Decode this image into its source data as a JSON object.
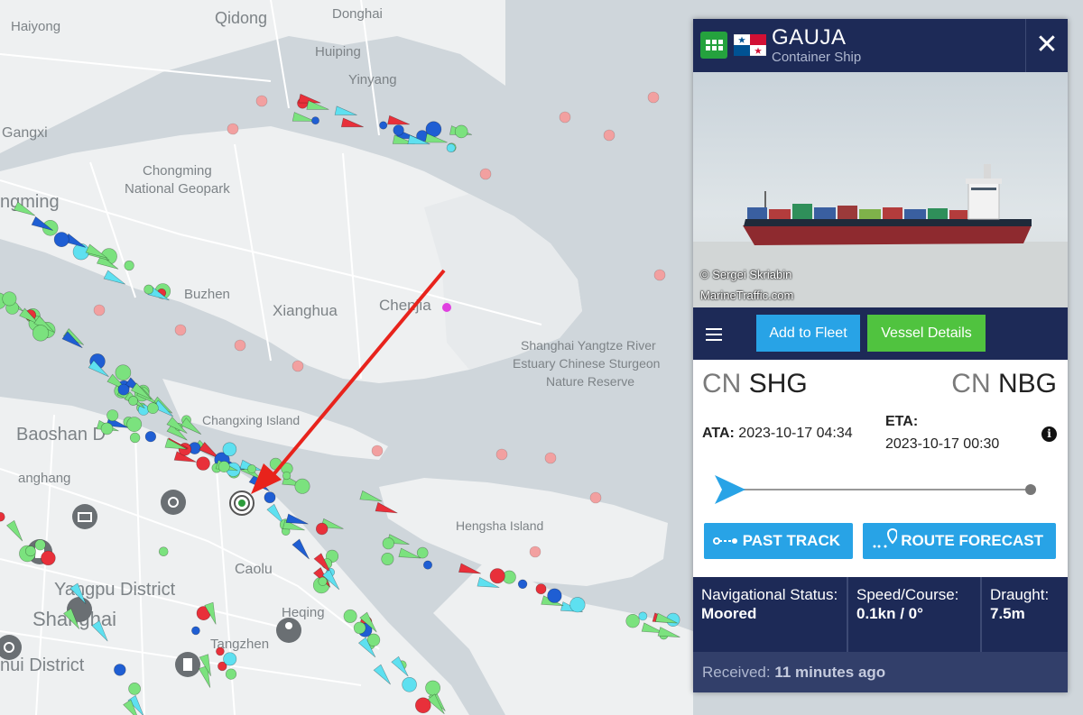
{
  "map": {
    "labels": {
      "qidong": "Qidong",
      "donghai": "Donghai",
      "haiyong": "Haiyong",
      "huiping": "Huiping",
      "yinyang": "Yinyang",
      "gangxi": "Gangxi",
      "chongming_geopark_1": "Chongming",
      "chongming_geopark_2": "National Geopark",
      "chongming": "ngming",
      "buzhen": "Buzhen",
      "xianghua": "Xianghua",
      "chenjia": "Chenjia",
      "reserve_1": "Shanghai Yangtze River",
      "reserve_2": "Estuary Chinese Sturgeon",
      "reserve_3": "Nature Reserve",
      "changxing": "Changxing Island",
      "baoshan": "Baoshan D",
      "hengsha": "Hengsha Island",
      "caolu": "Caolu",
      "yangpu": "Yangpu District",
      "shanghai": "Shanghai",
      "heqing": "Heqing",
      "tangzhen": "Tangzhen",
      "hui_district": "nui District",
      "yanghang": "anghang"
    }
  },
  "panel": {
    "vessel_name": "GAUJA",
    "vessel_type": "Container Ship",
    "flag": "Panama",
    "close_label": "✕",
    "photo_credit_1": "© Sergei Skriabin",
    "photo_credit_2": "MarineTraffic.com",
    "add_to_fleet": "Add to Fleet",
    "vessel_details": "Vessel Details",
    "from_country": "CN",
    "from_port": "SHG",
    "to_country": "CN",
    "to_port": "NBG",
    "ata_label": "ATA:",
    "ata_value": "2023-10-17 04:34",
    "eta_label": "ETA:",
    "eta_value": "2023-10-17 00:30",
    "info_icon": "i",
    "voyage_progress": 0,
    "past_track": "PAST TRACK",
    "route_forecast": "ROUTE FORECAST",
    "nav_status_label": "Navigational Status:",
    "nav_status_value": "Moored",
    "speed_label": "Speed/Course:",
    "speed_value": "0.1kn / 0°",
    "draught_label": "Draught:",
    "draught_value": "7.5m",
    "received_label": "Received:",
    "received_value": "11 minutes ago"
  },
  "colors": {
    "panel_header": "#1d2a57",
    "button_blue": "#28a3e6",
    "button_green": "#50c33f",
    "grid_green": "#25a23e",
    "water": "#cfd6db",
    "land": "#eef0f1",
    "cargo_vessel": "#7be27e",
    "tanker_vessel": "#e8303a",
    "passenger_vessel": "#1f5ed3",
    "tug_vessel": "#5ee0f0",
    "arrow_red": "#e8231c"
  },
  "icons": {
    "grid": "grid-icon",
    "close": "close-icon",
    "menu": "hamburger-menu-icon",
    "info": "info-icon",
    "past_track": "track-line-icon",
    "route_forecast": "route-pin-icon"
  }
}
